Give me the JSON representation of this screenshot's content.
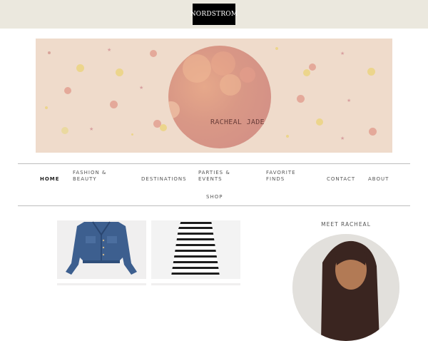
{
  "header": {
    "logo_text": "NORDSTROM"
  },
  "banner": {
    "blog_title": "RACHEAL JADE"
  },
  "nav": {
    "items": [
      {
        "label": "HOME"
      },
      {
        "label": "FASHION &\nBEAUTY"
      },
      {
        "label": "DESTINATIONS"
      },
      {
        "label": "PARTIES &\nEVENTS"
      },
      {
        "label": "FAVORITE\nFINDS"
      },
      {
        "label": "CONTACT"
      },
      {
        "label": "ABOUT"
      },
      {
        "label": "SHOP"
      }
    ]
  },
  "sidebar": {
    "meet_heading": "MEET RACHEAL"
  },
  "products": [
    {
      "name": "denim-jacket"
    },
    {
      "name": "striped-skirt"
    }
  ],
  "colors": {
    "topbar": "#ebe8de",
    "banner": "#efdbcb",
    "circle": "#d99886",
    "logo_bg": "#000000"
  }
}
